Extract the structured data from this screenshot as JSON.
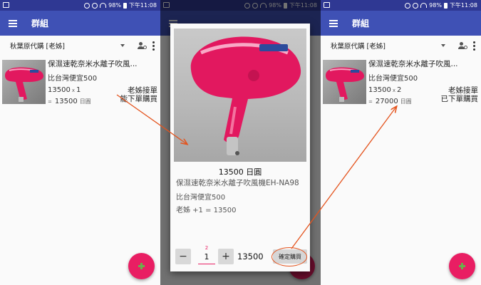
{
  "status_bar": {
    "battery": "98%",
    "time": "下午11:08"
  },
  "app_title": "群組",
  "group_selector": {
    "selected": "秋葉原代購 [老姊]"
  },
  "product": {
    "name_short": "保濕速乾奈米水離子吹風...",
    "name_full": "保濕速乾奈米水離子吹風機EH-NA98",
    "description": "比台灣便宜500",
    "unit_price": "13500",
    "currency": "日圓",
    "price_line": "13500 日圓"
  },
  "screen_before": {
    "quantity": "1",
    "total": "13500",
    "status_line1": "老姊接單",
    "status_line2": "能下單購買"
  },
  "dialog": {
    "order_line": "老姊 +1 = 13500",
    "quantity_hint": "2",
    "quantity": "1",
    "minus_label": "−",
    "plus_label": "+",
    "total": "13500",
    "confirm_label": "確定購買"
  },
  "screen_after": {
    "quantity": "2",
    "total": "27000",
    "status_line1": "老姊接單",
    "status_line2": "已下單購買"
  },
  "annotation_color": "#e4541e",
  "accent_colors": {
    "app_bar": "#3f51b5",
    "status_bar": "#2f3893",
    "fab": "#e91e63"
  },
  "icons": [
    "menu-icon",
    "dropdown-caret-icon",
    "group-settings-icon",
    "more-vert-icon",
    "add-icon",
    "hair-dryer-photo"
  ]
}
